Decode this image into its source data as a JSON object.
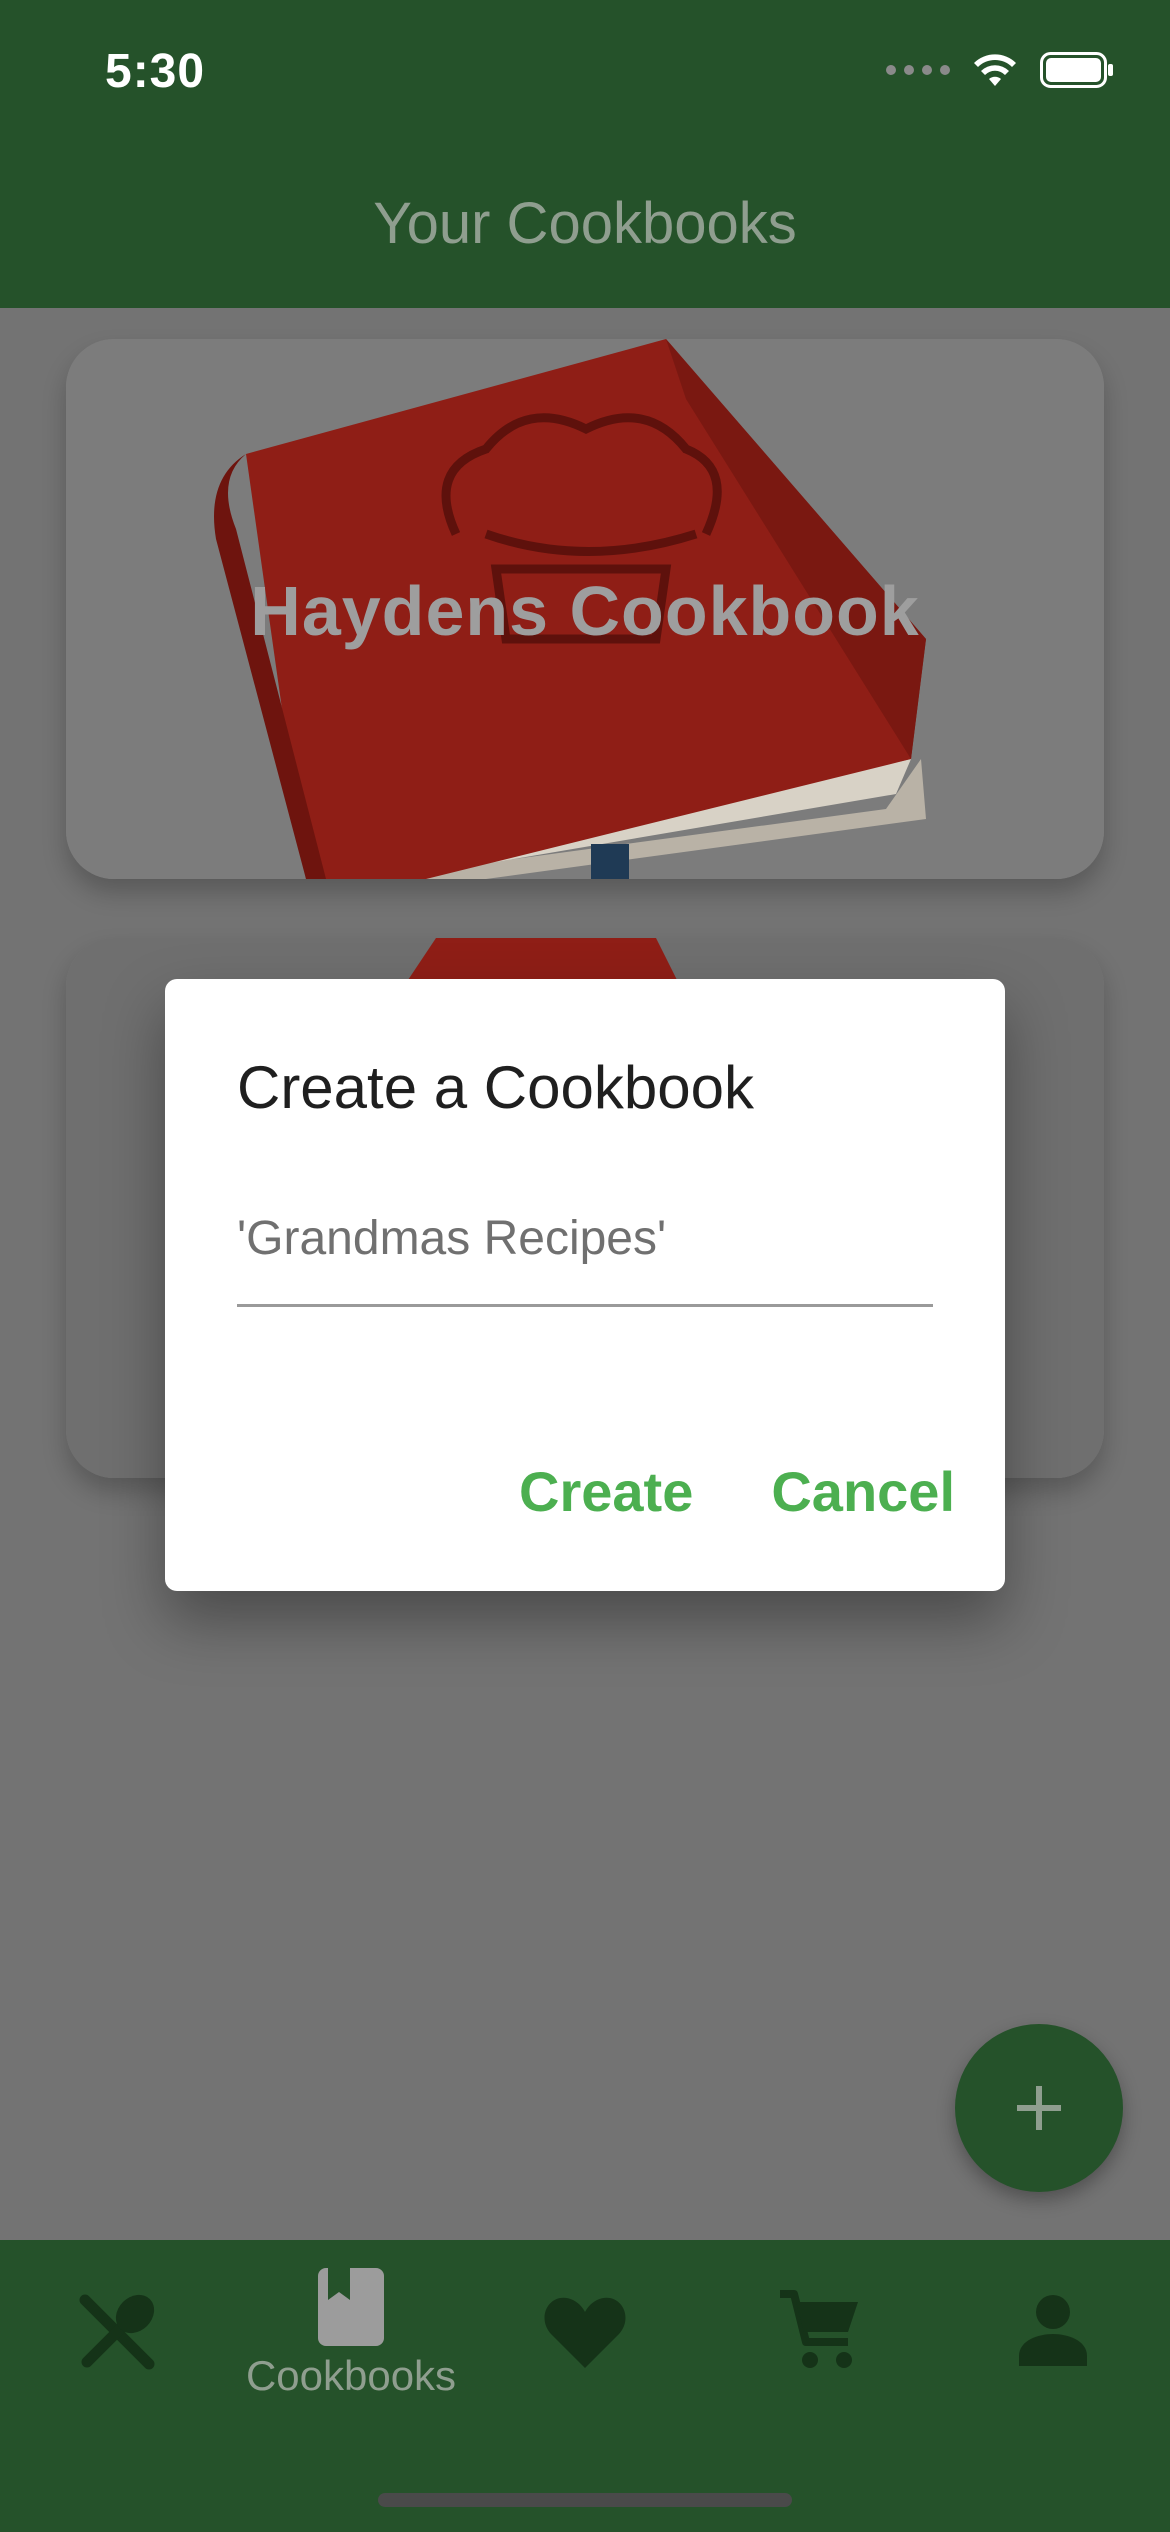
{
  "status_bar": {
    "time": "5:30"
  },
  "app_bar": {
    "title": "Your Cookbooks"
  },
  "cookbooks": [
    {
      "title": "Haydens Cookbook"
    },
    {
      "title": ""
    }
  ],
  "dialog": {
    "title": "Create a Cookbook",
    "input_placeholder": "'Grandmas Recipes'",
    "input_value": "",
    "create_label": "Create",
    "cancel_label": "Cancel"
  },
  "fab": {
    "icon": "plus-icon"
  },
  "bottom_nav": {
    "items": [
      {
        "icon": "utensils-icon",
        "label": ""
      },
      {
        "icon": "bookmark-book-icon",
        "label": "Cookbooks",
        "selected": true
      },
      {
        "icon": "heart-icon",
        "label": ""
      },
      {
        "icon": "cart-icon",
        "label": ""
      },
      {
        "icon": "person-icon",
        "label": ""
      }
    ]
  },
  "colors": {
    "primary": "#25522a",
    "accent": "#4caf50",
    "scrim": "#737373",
    "book_red": "#8f1e16"
  }
}
